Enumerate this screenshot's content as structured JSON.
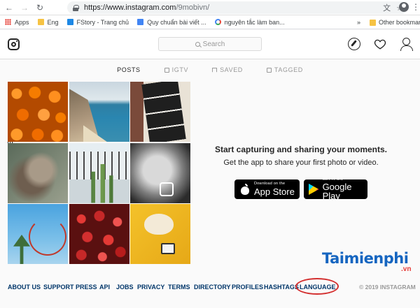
{
  "browser": {
    "url_host": "https://www.instagram.com",
    "url_path": "/9mobivn/",
    "bookmarks": [
      {
        "label": "Apps",
        "icon": "apps-icon"
      },
      {
        "label": "Eng",
        "icon": "folder-icon"
      },
      {
        "label": "FStory - Trang chủ",
        "icon": "fstory-icon"
      },
      {
        "label": "Quy chuẩn bài viết ...",
        "icon": "docs-icon"
      },
      {
        "label": "nguyên tắc làm ban...",
        "icon": "google-icon"
      }
    ],
    "more_label": "»",
    "other_bookmarks": "Other bookmarks"
  },
  "header": {
    "search_placeholder": "Search"
  },
  "tabs": [
    {
      "label": "POSTS",
      "active": true
    },
    {
      "label": "IGTV",
      "active": false
    },
    {
      "label": "SAVED",
      "active": false
    },
    {
      "label": "TAGGED",
      "active": false
    }
  ],
  "promo": {
    "title": "Start capturing and sharing your moments.",
    "subtitle": "Get the app to share your first photo or video.",
    "app_store": {
      "small": "Download on the",
      "big": "App Store"
    },
    "google_play": {
      "small": "GET IT ON",
      "big": "Google Play"
    }
  },
  "watermark": {
    "text": "Taimienphi",
    "suffix": ".vn"
  },
  "footer": {
    "links": [
      "ABOUT US",
      "SUPPORT",
      "PRESS",
      "API",
      "JOBS",
      "PRIVACY",
      "TERMS",
      "DIRECTORY",
      "PROFILES",
      "HASHTAGS",
      "LANGUAGE"
    ],
    "copyright": "© 2019 INSTAGRAM"
  },
  "colors": {
    "link": "#003569",
    "highlight": "#d32f2f",
    "watermark": "#1565c0"
  }
}
